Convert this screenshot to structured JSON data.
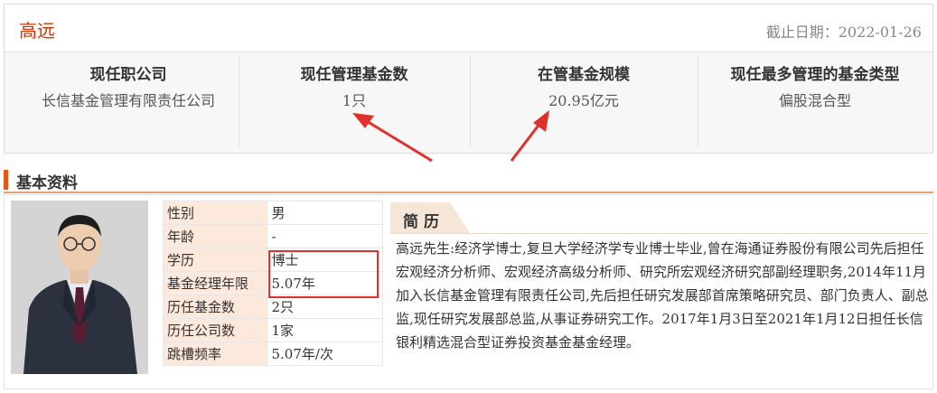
{
  "header": {
    "name": "高远",
    "cutoff_date": "截止日期：2022-01-26"
  },
  "stats": [
    {
      "label": "现任职公司",
      "value": "长信基金管理有限责任公司"
    },
    {
      "label": "现任管理基金数",
      "value": "1只"
    },
    {
      "label": "在管基金规模",
      "value": "20.95亿元"
    },
    {
      "label": "现任最多管理的基金类型",
      "value": "偏股混合型"
    }
  ],
  "basic_info": {
    "title": "基本资料",
    "fields": [
      {
        "key": "性别",
        "value": "男"
      },
      {
        "key": "年龄",
        "value": "-"
      },
      {
        "key": "学历",
        "value": "博士"
      },
      {
        "key": "基金经理年限",
        "value": "5.07年"
      },
      {
        "key": "历任基金数",
        "value": "2只"
      },
      {
        "key": "历任公司数",
        "value": "1家"
      },
      {
        "key": "跳槽频率",
        "value": "5.07年/次"
      }
    ]
  },
  "resume": {
    "title": "简历",
    "text": "高远先生:经济学博士,复旦大学经济学专业博士毕业,曾在海通证券股份有限公司先后担任宏观经济分析师、宏观经济高级分析师、研究所宏观经济研究部副经理职务,2014年11月加入长信基金管理有限责任公司,先后担任研究发展部首席策略研究员、部门负责人、副总监,现任研究发展部总监,从事证券研究工作。2017年1月3日至2021年1月12日担任长信银利精选混合型证券投资基金基金经理。"
  },
  "colors": {
    "accent": "#cc3300",
    "annotation": "#e0302c",
    "key_cell_bg": "#fde8dc"
  }
}
